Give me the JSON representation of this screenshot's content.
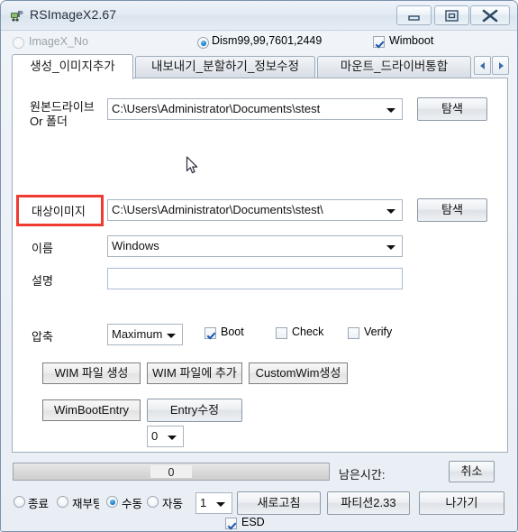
{
  "window": {
    "title": "RSImageX2.67",
    "icon": "app-icon",
    "buttons": {
      "minimize": "minimize-icon",
      "maximize": "maximize-icon",
      "close": "close-icon"
    }
  },
  "engine": {
    "imagex_label": "ImageX_No",
    "imagex_checked": false,
    "imagex_disabled": true,
    "dism_label": "Dism99,99,7601,2449",
    "dism_checked": true,
    "wimboot_label": "Wimboot",
    "wimboot_checked": true
  },
  "tabs": {
    "items": [
      {
        "label": "생성_이미지추가",
        "active": true
      },
      {
        "label": "내보내기_분할하기_정보수정",
        "active": false
      },
      {
        "label": "마운트_드라이버통합",
        "active": false
      }
    ],
    "nav_prev": "scroll-left-icon",
    "nav_next": "scroll-right-icon"
  },
  "form": {
    "source_label": "원본드라이브 Or 폴더",
    "source_value": "C:\\Users\\Administrator\\Documents\\stest",
    "source_browse": "탐색",
    "target_label": "대상이미지",
    "target_value": "C:\\Users\\Administrator\\Documents\\stest\\",
    "target_browse": "탐색",
    "name_label": "이름",
    "name_value": "Windows",
    "desc_label": "설명",
    "desc_value": "",
    "compress_label": "압축",
    "compress_value": "Maximum",
    "boot_label": "Boot",
    "boot_checked": true,
    "check_label": "Check",
    "check_checked": false,
    "verify_label": "Verify",
    "verify_checked": false
  },
  "actions": {
    "create_wim": "WIM 파일 생성",
    "append_wim": "WIM 파일에 추가",
    "custom_wim": "CustomWim생성",
    "wimboot_entry": "WimBootEntry",
    "entry_edit": "Entry수정",
    "entry_index": "0"
  },
  "status": {
    "progress_value": "0",
    "progress_percent": 0,
    "remaining_label": "남은시간:",
    "cancel_label": "취소"
  },
  "footer": {
    "radios": [
      {
        "label": "종료",
        "checked": false
      },
      {
        "label": "재부팅",
        "checked": false
      },
      {
        "label": "수동",
        "checked": true
      },
      {
        "label": "자동",
        "checked": false
      }
    ],
    "index_value": "1",
    "refresh_label": "새로고침",
    "partition_label": "파티션2.33",
    "exit_label": "나가기",
    "esd_label": "ESD",
    "esd_checked": true
  },
  "colors": {
    "highlight": "#ef3b32",
    "accent": "#1476c9"
  }
}
